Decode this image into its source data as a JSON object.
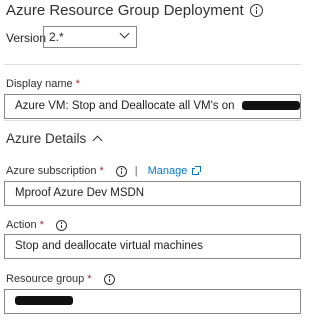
{
  "header": {
    "title": "Azure Resource Group Deployment"
  },
  "version": {
    "label": "Version",
    "value": "2.*"
  },
  "display_name": {
    "label": "Display name",
    "required_mark": "*",
    "value": "Azure VM: Stop and Deallocate all VM's on"
  },
  "azure_details": {
    "heading": "Azure Details"
  },
  "azure_subscription": {
    "label": "Azure subscription",
    "required_mark": "*",
    "separator": "|",
    "manage_label": "Manage",
    "value": "Mproof Azure Dev MSDN"
  },
  "action": {
    "label": "Action",
    "required_mark": "*",
    "value": "Stop and deallocate virtual machines"
  },
  "resource_group": {
    "label": "Resource group",
    "required_mark": "*",
    "value": ""
  },
  "colors": {
    "required": "#a4262c",
    "link": "#0078d4",
    "border": "#8a8886",
    "redaction": "#111111"
  }
}
